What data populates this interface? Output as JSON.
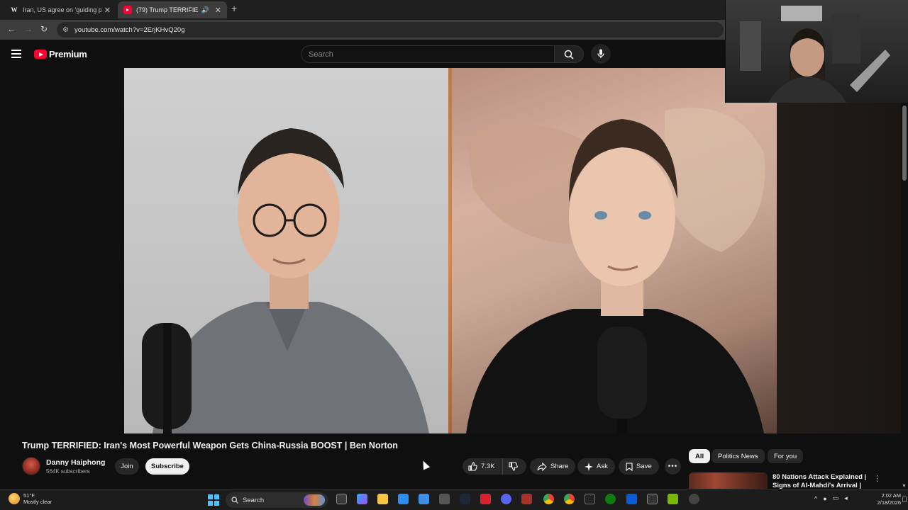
{
  "browser": {
    "tabs": [
      {
        "title": "Iran, US agree on 'guiding prin",
        "favicon": "wikipedia-icon",
        "active": false
      },
      {
        "title": "(79) Trump TERRIFIED: Iran",
        "favicon": "youtube-icon",
        "active": true
      }
    ],
    "url": "youtube.com/watch?v=2ErjKHvQ20g"
  },
  "masthead": {
    "brand": "Premium",
    "search_placeholder": "Search"
  },
  "video": {
    "title": "Trump TERRIFIED: Iran's Most Powerful Weapon Gets China-Russia BOOST | Ben Norton"
  },
  "channel": {
    "name": "Danny Haiphong",
    "subscribers": "564K subscribers",
    "join_label": "Join",
    "subscribe_label": "Subscribe"
  },
  "actions": {
    "likes": "7.3K",
    "share_label": "Share",
    "ask_label": "Ask",
    "save_label": "Save"
  },
  "chips": [
    "All",
    "Politics News",
    "For you"
  ],
  "recommendation": {
    "title": "80 Nations Attack Explained | Signs of Al-Mahdi's Arrival |"
  },
  "taskbar": {
    "weather_temp": "51°F",
    "weather_desc": "Mostly clear",
    "search_label": "Search",
    "time": "2:02 AM",
    "date": "2/18/2026"
  },
  "colors": {
    "youtube_red": "#ff0033",
    "background": "#0f0f0f",
    "windows_accent": "#4cc2ff"
  }
}
